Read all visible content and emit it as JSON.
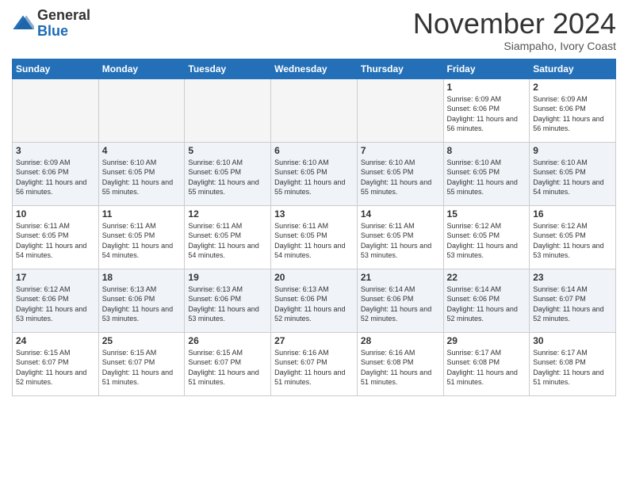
{
  "header": {
    "logo_general": "General",
    "logo_blue": "Blue",
    "month": "November 2024",
    "location": "Siampaho, Ivory Coast"
  },
  "days_of_week": [
    "Sunday",
    "Monday",
    "Tuesday",
    "Wednesday",
    "Thursday",
    "Friday",
    "Saturday"
  ],
  "weeks": [
    {
      "cells": [
        {
          "day": null,
          "empty": true
        },
        {
          "day": null,
          "empty": true
        },
        {
          "day": null,
          "empty": true
        },
        {
          "day": null,
          "empty": true
        },
        {
          "day": null,
          "empty": true
        },
        {
          "day": 1,
          "sunrise": "6:09 AM",
          "sunset": "6:06 PM",
          "daylight": "11 hours and 56 minutes."
        },
        {
          "day": 2,
          "sunrise": "6:09 AM",
          "sunset": "6:06 PM",
          "daylight": "11 hours and 56 minutes."
        }
      ]
    },
    {
      "cells": [
        {
          "day": 3,
          "sunrise": "6:09 AM",
          "sunset": "6:06 PM",
          "daylight": "11 hours and 56 minutes."
        },
        {
          "day": 4,
          "sunrise": "6:10 AM",
          "sunset": "6:05 PM",
          "daylight": "11 hours and 55 minutes."
        },
        {
          "day": 5,
          "sunrise": "6:10 AM",
          "sunset": "6:05 PM",
          "daylight": "11 hours and 55 minutes."
        },
        {
          "day": 6,
          "sunrise": "6:10 AM",
          "sunset": "6:05 PM",
          "daylight": "11 hours and 55 minutes."
        },
        {
          "day": 7,
          "sunrise": "6:10 AM",
          "sunset": "6:05 PM",
          "daylight": "11 hours and 55 minutes."
        },
        {
          "day": 8,
          "sunrise": "6:10 AM",
          "sunset": "6:05 PM",
          "daylight": "11 hours and 55 minutes."
        },
        {
          "day": 9,
          "sunrise": "6:10 AM",
          "sunset": "6:05 PM",
          "daylight": "11 hours and 54 minutes."
        }
      ]
    },
    {
      "cells": [
        {
          "day": 10,
          "sunrise": "6:11 AM",
          "sunset": "6:05 PM",
          "daylight": "11 hours and 54 minutes."
        },
        {
          "day": 11,
          "sunrise": "6:11 AM",
          "sunset": "6:05 PM",
          "daylight": "11 hours and 54 minutes."
        },
        {
          "day": 12,
          "sunrise": "6:11 AM",
          "sunset": "6:05 PM",
          "daylight": "11 hours and 54 minutes."
        },
        {
          "day": 13,
          "sunrise": "6:11 AM",
          "sunset": "6:05 PM",
          "daylight": "11 hours and 54 minutes."
        },
        {
          "day": 14,
          "sunrise": "6:11 AM",
          "sunset": "6:05 PM",
          "daylight": "11 hours and 53 minutes."
        },
        {
          "day": 15,
          "sunrise": "6:12 AM",
          "sunset": "6:05 PM",
          "daylight": "11 hours and 53 minutes."
        },
        {
          "day": 16,
          "sunrise": "6:12 AM",
          "sunset": "6:05 PM",
          "daylight": "11 hours and 53 minutes."
        }
      ]
    },
    {
      "cells": [
        {
          "day": 17,
          "sunrise": "6:12 AM",
          "sunset": "6:06 PM",
          "daylight": "11 hours and 53 minutes."
        },
        {
          "day": 18,
          "sunrise": "6:13 AM",
          "sunset": "6:06 PM",
          "daylight": "11 hours and 53 minutes."
        },
        {
          "day": 19,
          "sunrise": "6:13 AM",
          "sunset": "6:06 PM",
          "daylight": "11 hours and 53 minutes."
        },
        {
          "day": 20,
          "sunrise": "6:13 AM",
          "sunset": "6:06 PM",
          "daylight": "11 hours and 52 minutes."
        },
        {
          "day": 21,
          "sunrise": "6:14 AM",
          "sunset": "6:06 PM",
          "daylight": "11 hours and 52 minutes."
        },
        {
          "day": 22,
          "sunrise": "6:14 AM",
          "sunset": "6:06 PM",
          "daylight": "11 hours and 52 minutes."
        },
        {
          "day": 23,
          "sunrise": "6:14 AM",
          "sunset": "6:07 PM",
          "daylight": "11 hours and 52 minutes."
        }
      ]
    },
    {
      "cells": [
        {
          "day": 24,
          "sunrise": "6:15 AM",
          "sunset": "6:07 PM",
          "daylight": "11 hours and 52 minutes."
        },
        {
          "day": 25,
          "sunrise": "6:15 AM",
          "sunset": "6:07 PM",
          "daylight": "11 hours and 51 minutes."
        },
        {
          "day": 26,
          "sunrise": "6:15 AM",
          "sunset": "6:07 PM",
          "daylight": "11 hours and 51 minutes."
        },
        {
          "day": 27,
          "sunrise": "6:16 AM",
          "sunset": "6:07 PM",
          "daylight": "11 hours and 51 minutes."
        },
        {
          "day": 28,
          "sunrise": "6:16 AM",
          "sunset": "6:08 PM",
          "daylight": "11 hours and 51 minutes."
        },
        {
          "day": 29,
          "sunrise": "6:17 AM",
          "sunset": "6:08 PM",
          "daylight": "11 hours and 51 minutes."
        },
        {
          "day": 30,
          "sunrise": "6:17 AM",
          "sunset": "6:08 PM",
          "daylight": "11 hours and 51 minutes."
        }
      ]
    }
  ]
}
